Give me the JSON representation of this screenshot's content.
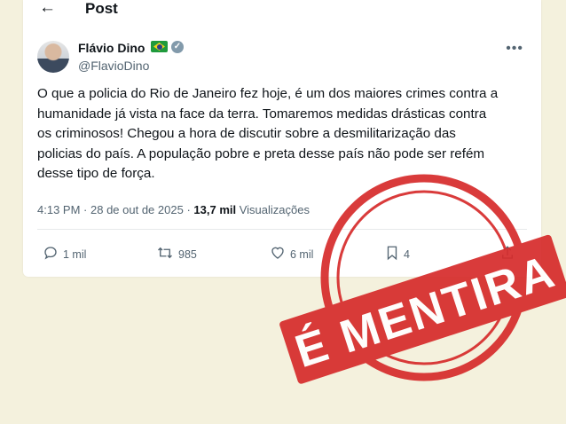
{
  "header": {
    "title": "Post"
  },
  "post": {
    "author_name": "Flávio Dino",
    "handle": "@FlavioDino",
    "text": "O que a policia do Rio de Janeiro fez hoje, é um dos maiores crimes contra a humanidade já vista na face da terra. Tomaremos medidas drásticas contra os criminosos! Chegou a hora de discutir sobre a desmilitarização das policias do país. A população pobre e preta desse país não pode ser refém desse tipo de força.",
    "time": "4:13 PM",
    "date": "28 de out de 2025",
    "views_count": "13,7 mil",
    "views_label": "Visualizações"
  },
  "actions": {
    "replies": "1 mil",
    "reposts": "985",
    "likes": "6 mil",
    "bookmarks": "4"
  },
  "stamp": {
    "text": "É MENTIRA",
    "color": "#d62b2b"
  },
  "icons": [
    "back-arrow-icon",
    "flag-brazil-icon",
    "verified-icon",
    "more-icon",
    "reply-icon",
    "repost-icon",
    "like-icon",
    "bookmark-icon",
    "share-icon"
  ]
}
